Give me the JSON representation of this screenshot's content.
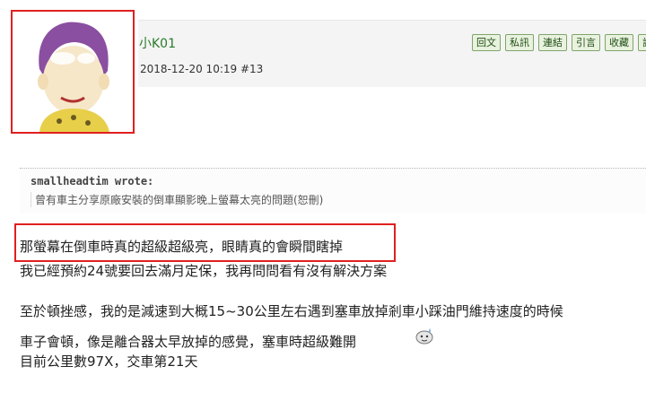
{
  "post": {
    "username": "小K01",
    "timestamp": "2018-12-20 10:19",
    "floor": "#13",
    "actions": [
      "回文",
      "私訊",
      "連結",
      "引言",
      "收藏",
      "評"
    ]
  },
  "quote": {
    "author": "smallheadtim wrote:",
    "text": "曾有車主分享原廠安裝的倒車顯影晚上螢幕太亮的問題(恕刪)"
  },
  "body": {
    "line1": "那螢幕在倒車時真的超級超級亮，眼睛真的會瞬間瞎掉",
    "line2": "我已經預約24號要回去滿月定保，我再問問看有沒有解決方案",
    "line3": "至於頓挫感，我的是減速到大概15~30公里左右遇到塞車放掉剎車小踩油門維持速度的時候",
    "line4": "車子會頓，像是離合器太早放掉的感覺，塞車時超級難開",
    "line5": "目前公里數97X，交車第21天"
  },
  "colors": {
    "highlight_border": "#e02020",
    "username": "#2a7a2a",
    "button_bg": "#e9f2df",
    "button_border": "#7fa56a"
  },
  "icons": {
    "avatar": "cartoon-boy-avatar",
    "emoticon": "sweat-emoticon-icon"
  }
}
